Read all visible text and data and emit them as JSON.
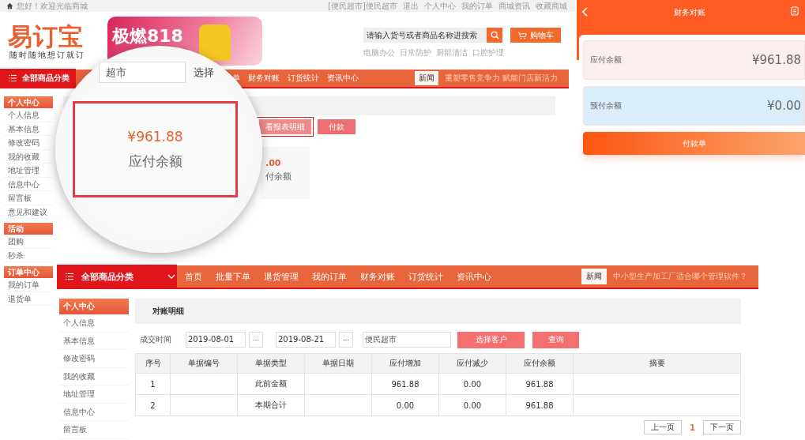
{
  "back_page": {
    "top_bar": {
      "greeting": "您好！欢迎光临商城",
      "links": [
        "[便民超市]便民超市",
        "退出",
        "个人中心",
        "我的订单",
        "商城资讯",
        "收藏商城"
      ]
    },
    "header": {
      "logo": "易订宝",
      "slogan": "随时随地想订就订",
      "banner": "极燃818",
      "search": {
        "placeholder": "请输入货号或者商品名称进搜索"
      },
      "cart": "购物车",
      "hot_words": [
        "电脑办公",
        "日常防护",
        "厨部清洁",
        "口腔护理"
      ]
    },
    "nav": {
      "category": "全部商品分类",
      "items": [
        "单",
        "财务对账",
        "订货统计",
        "资讯中心"
      ],
      "news_label": "新闻",
      "news": "重塑零售竞争力 赋能门店新活力"
    },
    "sidebar": [
      {
        "title": "个人中心",
        "items": [
          "个人信息",
          "基本信息",
          "修改密码",
          "我的收藏",
          "地址管理",
          "信息中心",
          "留言板",
          "意见和建议"
        ]
      },
      {
        "title": "活动",
        "items": [
          "团购",
          "秒杀"
        ]
      },
      {
        "title": "订单中心",
        "items": [
          "我的订单",
          "退货单"
        ]
      }
    ],
    "content": {
      "buttons": [
        {
          "label": "看报表明细",
          "kind": "outlined"
        },
        {
          "label": "付款",
          "kind": "filled"
        }
      ],
      "card": {
        "amount": ".00",
        "label": "付余额"
      }
    }
  },
  "magnifier": {
    "field_value": "超市",
    "field_label": "选择",
    "amount": "¥961.88",
    "label": "应付余额"
  },
  "mobile": {
    "title": "财务对账",
    "cards": [
      {
        "label": "应付余额",
        "amount": "¥961.88",
        "color": "#fdeeee"
      },
      {
        "label": "预付余额",
        "amount": "¥0.00",
        "color": "#d9eef8"
      }
    ],
    "button": "付款单"
  },
  "front_page": {
    "nav": {
      "category": "全部商品分类",
      "items": [
        "首页",
        "批量下单",
        "退货管理",
        "我的订单",
        "财务对账",
        "订货统计",
        "资讯中心"
      ],
      "news_label": "新闻",
      "news": "中小型生产加工厂适合哪个管理软件？"
    },
    "sidebar": {
      "title": "个人中心",
      "items": [
        "个人信息",
        "基本信息",
        "修改密码",
        "我的收藏",
        "地址管理",
        "信息中心",
        "留言板"
      ]
    },
    "title": "对账明细",
    "filter": {
      "label": "成交时间",
      "start": "2019-08-01",
      "end": "2019-08-21",
      "customer": "便民超市",
      "buttons": [
        "选择客户",
        "查询"
      ]
    },
    "table": {
      "columns": [
        "序号",
        "单据编号",
        "单据类型",
        "单据日期",
        "应付增加",
        "应付减少",
        "应付余额",
        "摘要"
      ],
      "rows": [
        [
          "1",
          "",
          "此前金额",
          "",
          "961.88",
          "0.00",
          "961.88",
          ""
        ],
        [
          "2",
          "",
          "本期合计",
          "",
          "0.00",
          "0.00",
          "961.88",
          ""
        ]
      ]
    },
    "pagination": {
      "prev": "上一页",
      "pages": [
        {
          "label": "1",
          "selected": true
        }
      ],
      "next": "下一页"
    }
  }
}
